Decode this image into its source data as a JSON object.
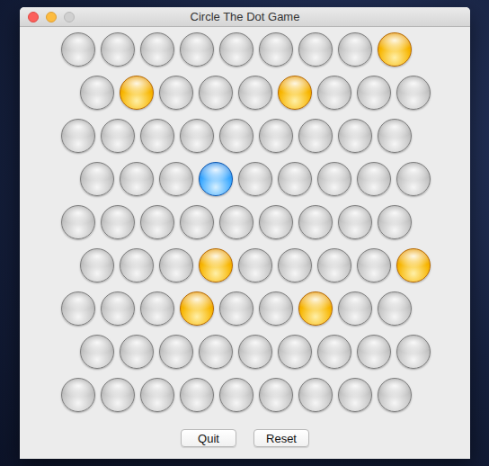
{
  "window": {
    "title": "Circle The Dot Game"
  },
  "grid": [
    {
      "cells": [
        {
          "kind": "empty"
        },
        {
          "kind": "empty"
        },
        {
          "kind": "empty"
        },
        {
          "kind": "empty"
        },
        {
          "kind": "empty"
        },
        {
          "kind": "empty"
        },
        {
          "kind": "empty"
        },
        {
          "kind": "empty"
        },
        {
          "kind": "blocked"
        }
      ]
    },
    {
      "cells": [
        {
          "kind": "empty"
        },
        {
          "kind": "blocked"
        },
        {
          "kind": "empty"
        },
        {
          "kind": "empty"
        },
        {
          "kind": "empty"
        },
        {
          "kind": "blocked"
        },
        {
          "kind": "empty"
        },
        {
          "kind": "empty"
        },
        {
          "kind": "empty"
        }
      ]
    },
    {
      "cells": [
        {
          "kind": "empty"
        },
        {
          "kind": "empty"
        },
        {
          "kind": "empty"
        },
        {
          "kind": "empty"
        },
        {
          "kind": "empty"
        },
        {
          "kind": "empty"
        },
        {
          "kind": "empty"
        },
        {
          "kind": "empty"
        },
        {
          "kind": "empty"
        }
      ]
    },
    {
      "cells": [
        {
          "kind": "empty"
        },
        {
          "kind": "empty"
        },
        {
          "kind": "empty"
        },
        {
          "kind": "dot"
        },
        {
          "kind": "empty"
        },
        {
          "kind": "empty"
        },
        {
          "kind": "empty"
        },
        {
          "kind": "empty"
        },
        {
          "kind": "empty"
        }
      ]
    },
    {
      "cells": [
        {
          "kind": "empty"
        },
        {
          "kind": "empty"
        },
        {
          "kind": "empty"
        },
        {
          "kind": "empty"
        },
        {
          "kind": "empty"
        },
        {
          "kind": "empty"
        },
        {
          "kind": "empty"
        },
        {
          "kind": "empty"
        },
        {
          "kind": "empty"
        }
      ]
    },
    {
      "cells": [
        {
          "kind": "empty"
        },
        {
          "kind": "empty"
        },
        {
          "kind": "empty"
        },
        {
          "kind": "blocked"
        },
        {
          "kind": "empty"
        },
        {
          "kind": "empty"
        },
        {
          "kind": "empty"
        },
        {
          "kind": "empty"
        },
        {
          "kind": "blocked"
        }
      ]
    },
    {
      "cells": [
        {
          "kind": "empty"
        },
        {
          "kind": "empty"
        },
        {
          "kind": "empty"
        },
        {
          "kind": "blocked"
        },
        {
          "kind": "empty"
        },
        {
          "kind": "empty"
        },
        {
          "kind": "blocked"
        },
        {
          "kind": "empty"
        },
        {
          "kind": "empty"
        }
      ]
    },
    {
      "cells": [
        {
          "kind": "empty"
        },
        {
          "kind": "empty"
        },
        {
          "kind": "empty"
        },
        {
          "kind": "empty"
        },
        {
          "kind": "empty"
        },
        {
          "kind": "empty"
        },
        {
          "kind": "empty"
        },
        {
          "kind": "empty"
        },
        {
          "kind": "empty"
        }
      ]
    },
    {
      "cells": [
        {
          "kind": "empty"
        },
        {
          "kind": "empty"
        },
        {
          "kind": "empty"
        },
        {
          "kind": "empty"
        },
        {
          "kind": "empty"
        },
        {
          "kind": "empty"
        },
        {
          "kind": "empty"
        },
        {
          "kind": "empty"
        },
        {
          "kind": "empty"
        }
      ]
    }
  ],
  "buttons": [
    "Quit",
    "Reset"
  ]
}
